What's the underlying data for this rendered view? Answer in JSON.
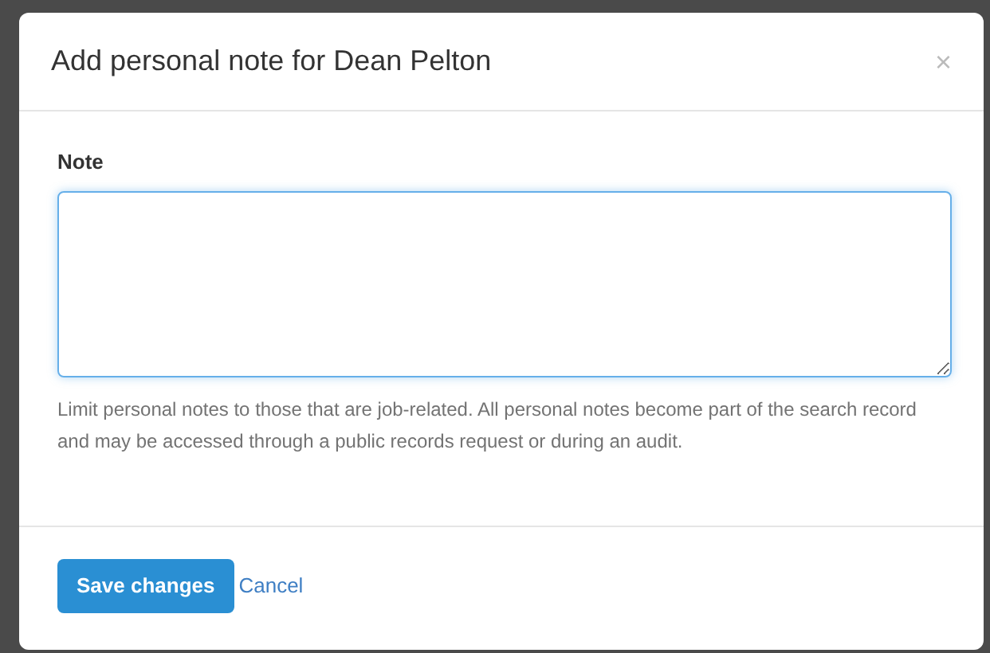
{
  "dialog": {
    "title": "Add personal note for Dean Pelton",
    "close": "×"
  },
  "note_field": {
    "label": "Note",
    "help": "Limit personal notes to those that are job-related. All personal notes become part of the search record and may be accessed through a public records request or during an audit."
  },
  "buttons": {
    "save": "Save changes",
    "cancel": "Cancel"
  }
}
